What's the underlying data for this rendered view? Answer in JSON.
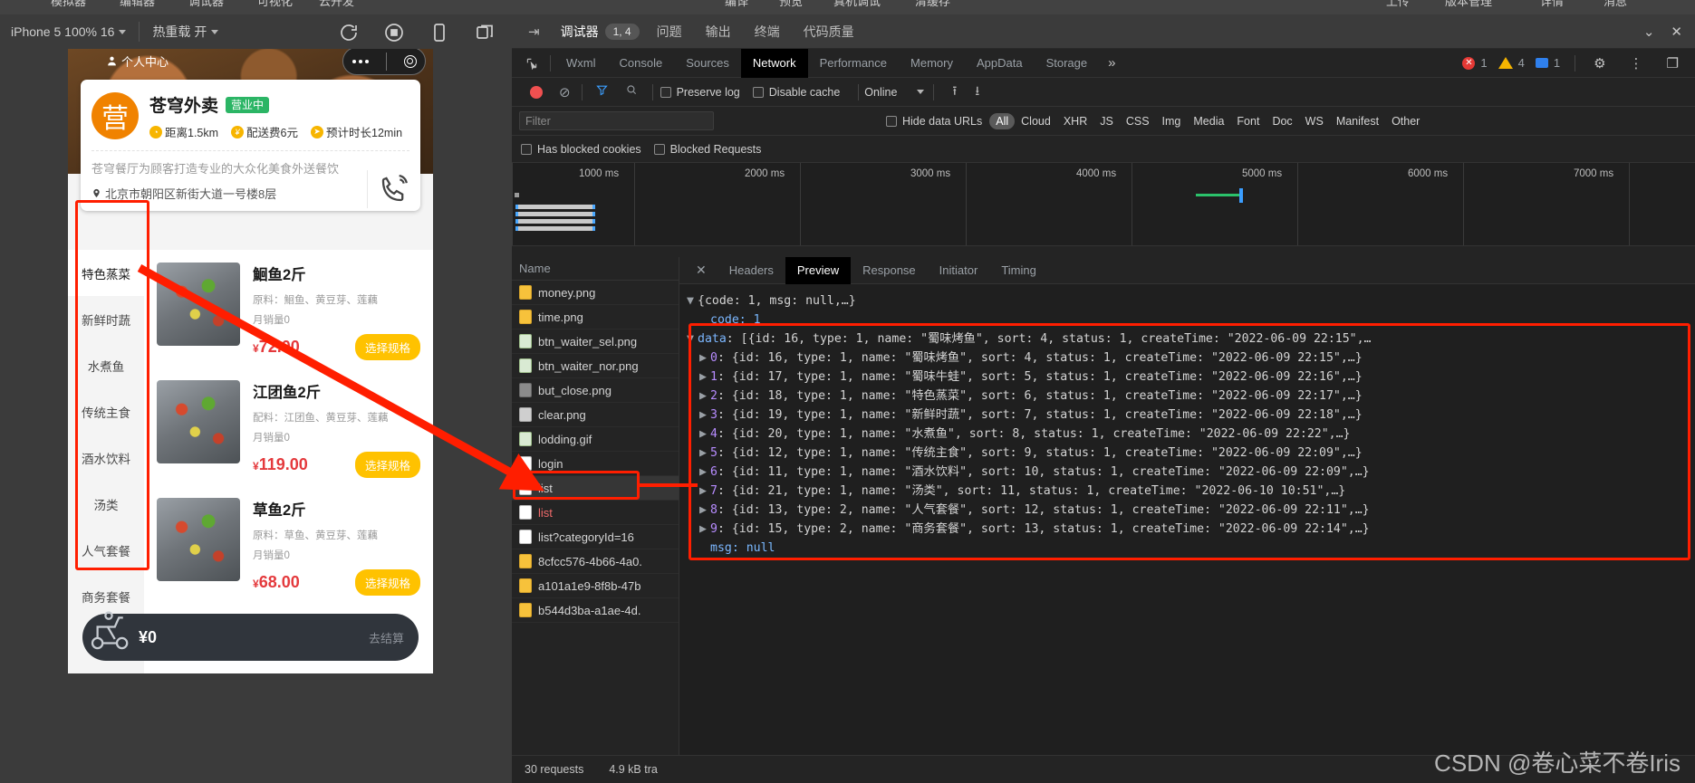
{
  "ide_menu": {
    "left_items": [
      "模拟器",
      "编辑器",
      "调试器",
      "可视化",
      "云开发"
    ],
    "mid_items": [
      "编译",
      "预览",
      "真机调试",
      "清缓存"
    ],
    "right_items": [
      "上传",
      "版本管理",
      "详情",
      "消息"
    ]
  },
  "simulator": {
    "device_label": "iPhone 5 100% 16",
    "hot_reload_label": "热重载 开",
    "icons": [
      "refresh-icon",
      "stop-icon",
      "rotate-device-icon",
      "multi-window-icon"
    ]
  },
  "phone": {
    "statusbar": {
      "left_text": "个人中心"
    },
    "shop": {
      "name": "苍穹外卖",
      "status_badge": "营业中",
      "distance": "距离1.5km",
      "delivery_fee": "配送费6元",
      "eta": "预计时长12min",
      "description": "苍穹餐厅为顾客打造专业的大众化美食外送餐饮",
      "address": "北京市朝阳区新街大道一号楼8层"
    },
    "categories": [
      {
        "label": "特色蒸菜",
        "active": true
      },
      {
        "label": "新鲜时蔬",
        "active": false
      },
      {
        "label": "水煮鱼",
        "active": false
      },
      {
        "label": "传统主食",
        "active": false
      },
      {
        "label": "酒水饮料",
        "active": false
      },
      {
        "label": "汤类",
        "active": false
      },
      {
        "label": "人气套餐",
        "active": false
      },
      {
        "label": "商务套餐",
        "active": false
      }
    ],
    "dishes": [
      {
        "name": "鮰鱼2斤",
        "ingredients": "原料：鮰鱼、黄豆芽、莲藕",
        "sold": "月销量0",
        "price": "72.00",
        "currency": "¥",
        "spec_button": "选择规格"
      },
      {
        "name": "江团鱼2斤",
        "ingredients": "配料：江团鱼、黄豆芽、莲藕",
        "sold": "月销量0",
        "price": "119.00",
        "currency": "¥",
        "spec_button": "选择规格"
      },
      {
        "name": "草鱼2斤",
        "ingredients": "原料：草鱼、黄豆芽、莲藕",
        "sold": "月销量0",
        "price": "68.00",
        "currency": "¥",
        "spec_button": "选择规格"
      }
    ],
    "cart": {
      "total": "¥0",
      "go_label": "去结算"
    }
  },
  "devtools": {
    "header": {
      "tabs": [
        {
          "label": "调试器",
          "selected": true,
          "count": "1, 4"
        },
        {
          "label": "问题",
          "selected": false
        },
        {
          "label": "输出",
          "selected": false
        },
        {
          "label": "终端",
          "selected": false
        },
        {
          "label": "代码质量",
          "selected": false
        }
      ]
    },
    "panel_tabs": [
      {
        "label": "Wxml",
        "selected": false
      },
      {
        "label": "Console",
        "selected": false
      },
      {
        "label": "Sources",
        "selected": false
      },
      {
        "label": "Network",
        "selected": true
      },
      {
        "label": "Performance",
        "selected": false
      },
      {
        "label": "Memory",
        "selected": false
      },
      {
        "label": "AppData",
        "selected": false
      },
      {
        "label": "Storage",
        "selected": false
      }
    ],
    "status_counts": {
      "errors": "1",
      "warnings": "4",
      "infos": "1"
    },
    "controls": {
      "preserve_log": "Preserve log",
      "disable_cache": "Disable cache",
      "throttling": "Online",
      "preserve_log_checked": false,
      "disable_cache_checked": false
    },
    "filter": {
      "placeholder": "Filter",
      "value": "",
      "hide_data_urls": "Hide data URLs",
      "hide_data_urls_checked": false,
      "types": [
        "All",
        "Cloud",
        "XHR",
        "JS",
        "CSS",
        "Img",
        "Media",
        "Font",
        "Doc",
        "WS",
        "Manifest",
        "Other"
      ],
      "selected_type": "All",
      "has_blocked_cookies": "Has blocked cookies",
      "blocked_requests": "Blocked Requests",
      "has_blocked_cookies_checked": false,
      "blocked_requests_checked": false
    },
    "timeline": {
      "ticks": [
        "1000 ms",
        "2000 ms",
        "3000 ms",
        "4000 ms",
        "5000 ms",
        "6000 ms",
        "7000 ms"
      ]
    },
    "requests": {
      "column_header": "Name",
      "rows": [
        {
          "name": "money.png",
          "icon": "png",
          "state": "normal"
        },
        {
          "name": "time.png",
          "icon": "png",
          "state": "normal"
        },
        {
          "name": "btn_waiter_sel.png",
          "icon": "img",
          "state": "normal"
        },
        {
          "name": "btn_waiter_nor.png",
          "icon": "img",
          "state": "normal"
        },
        {
          "name": "but_close.png",
          "icon": "dark",
          "state": "normal"
        },
        {
          "name": "clear.png",
          "icon": "gray",
          "state": "normal"
        },
        {
          "name": "lodding.gif",
          "icon": "img",
          "state": "normal"
        },
        {
          "name": "login",
          "icon": "doc",
          "state": "normal"
        },
        {
          "name": "list",
          "icon": "doc",
          "state": "selected"
        },
        {
          "name": "list",
          "icon": "doc",
          "state": "error"
        },
        {
          "name": "list?categoryId=16",
          "icon": "doc",
          "state": "normal"
        },
        {
          "name": "8cfcc576-4b66-4a0.",
          "icon": "png",
          "state": "normal"
        },
        {
          "name": "a101a1e9-8f8b-47b",
          "icon": "png",
          "state": "normal"
        },
        {
          "name": "b544d3ba-a1ae-4d.",
          "icon": "png",
          "state": "normal"
        }
      ]
    },
    "preview": {
      "tabs": [
        {
          "label": "Headers",
          "selected": false
        },
        {
          "label": "Preview",
          "selected": true
        },
        {
          "label": "Response",
          "selected": false
        },
        {
          "label": "Initiator",
          "selected": false
        },
        {
          "label": "Timing",
          "selected": false
        }
      ],
      "json_lines": [
        {
          "indent": 0,
          "tri": "▼",
          "text": "{code: 1, msg: null,…}"
        },
        {
          "indent": 1,
          "tri": "",
          "key": "code",
          "text": ": 1",
          "dim": true
        },
        {
          "indent": 1,
          "tri": "▼",
          "key": "data",
          "text": ": [{id: 16, type: 1, name: \"蜀味烤鱼\", sort: 4, status: 1, createTime: \"2022-06-09 22:15\",…"
        },
        {
          "indent": 2,
          "tri": "▶",
          "key": "0",
          "text": ": {id: 16, type: 1, name: \"蜀味烤鱼\", sort: 4, status: 1, createTime: \"2022-06-09 22:15\",…}"
        },
        {
          "indent": 2,
          "tri": "▶",
          "key": "1",
          "text": ": {id: 17, type: 1, name: \"蜀味牛蛙\", sort: 5, status: 1, createTime: \"2022-06-09 22:16\",…}"
        },
        {
          "indent": 2,
          "tri": "▶",
          "key": "2",
          "text": ": {id: 18, type: 1, name: \"特色蒸菜\", sort: 6, status: 1, createTime: \"2022-06-09 22:17\",…}"
        },
        {
          "indent": 2,
          "tri": "▶",
          "key": "3",
          "text": ": {id: 19, type: 1, name: \"新鲜时蔬\", sort: 7, status: 1, createTime: \"2022-06-09 22:18\",…}"
        },
        {
          "indent": 2,
          "tri": "▶",
          "key": "4",
          "text": ": {id: 20, type: 1, name: \"水煮鱼\", sort: 8, status: 1, createTime: \"2022-06-09 22:22\",…}"
        },
        {
          "indent": 2,
          "tri": "▶",
          "key": "5",
          "text": ": {id: 12, type: 1, name: \"传统主食\", sort: 9, status: 1, createTime: \"2022-06-09 22:09\",…}"
        },
        {
          "indent": 2,
          "tri": "▶",
          "key": "6",
          "text": ": {id: 11, type: 1, name: \"酒水饮料\", sort: 10, status: 1, createTime: \"2022-06-09 22:09\",…}"
        },
        {
          "indent": 2,
          "tri": "▶",
          "key": "7",
          "text": ": {id: 21, type: 1, name: \"汤类\", sort: 11, status: 1, createTime: \"2022-06-10 10:51\",…}"
        },
        {
          "indent": 2,
          "tri": "▶",
          "key": "8",
          "text": ": {id: 13, type: 2, name: \"人气套餐\", sort: 12, status: 1, createTime: \"2022-06-09 22:11\",…}"
        },
        {
          "indent": 2,
          "tri": "▶",
          "key": "9",
          "text": ": {id: 15, type: 2, name: \"商务套餐\", sort: 13, status: 1, createTime: \"2022-06-09 22:14\",…}"
        },
        {
          "indent": 1,
          "tri": "",
          "key": "msg",
          "text": ": null",
          "msg": true
        }
      ]
    },
    "status_bar": {
      "requests": "30 requests",
      "transferred": "4.9 kB tra"
    }
  },
  "watermark": "CSDN @卷心菜不卷Iris",
  "colors": {
    "accent_red": "#ff1e00",
    "brand_orange": "#f08200",
    "open_green": "#2bb565",
    "price_red": "#e4393c",
    "spec_yellow": "#ffc200"
  }
}
